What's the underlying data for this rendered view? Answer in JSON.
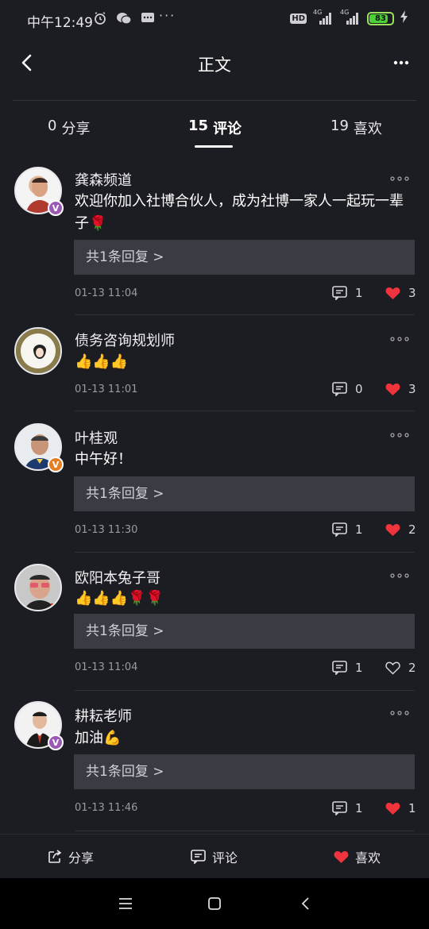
{
  "status_bar": {
    "time": "中午12:49",
    "icons": [
      "alarm-icon",
      "wechat-icon",
      "message-icon"
    ],
    "more": "···",
    "network_1": "4G",
    "network_2": "4G",
    "battery": "83",
    "battery_level": 0.83,
    "battery_color": "#4cd137"
  },
  "header": {
    "title": "正文",
    "back_icon": "chevron-left-icon",
    "more_icon": "more-horizontal-icon"
  },
  "tabs": [
    {
      "count": "0",
      "label": "分享"
    },
    {
      "count": "15",
      "label": "评论"
    },
    {
      "count": "19",
      "label": "喜欢"
    }
  ],
  "comments": [
    {
      "author": "龚森频道",
      "text": "欢迎你加入社博合伙人，成为社博一家人一起玩一辈子🌹",
      "reply": "共1条回复 >",
      "time": "01-13 11:04",
      "comment_count": "1",
      "like_count": "3",
      "liked": true,
      "badge": "V"
    },
    {
      "author": "债务咨询规划师",
      "text": "👍👍👍",
      "reply": "",
      "time": "01-13 11:01",
      "comment_count": "0",
      "like_count": "3",
      "liked": true,
      "badge": ""
    },
    {
      "author": "叶桂观",
      "text": "中午好！",
      "reply": "共1条回复 >",
      "time": "01-13 11:30",
      "comment_count": "1",
      "like_count": "2",
      "liked": true,
      "badge": "V"
    },
    {
      "author": "欧阳本兔子哥",
      "text": "👍👍👍🌹🌹",
      "reply": "共1条回复 >",
      "time": "01-13 11:04",
      "comment_count": "1",
      "like_count": "2",
      "liked": false,
      "badge": ""
    },
    {
      "author": "耕耘老师",
      "text": "加油💪",
      "reply": "共1条回复 >",
      "time": "01-13 11:46",
      "comment_count": "1",
      "like_count": "1",
      "liked": true,
      "badge": "V"
    }
  ],
  "action_bar": {
    "share": "分享",
    "comment": "评论",
    "like": "喜欢"
  },
  "colors": {
    "background": "#1c1c23",
    "like_red": "#f0343e",
    "reply_box": "#3b3b43",
    "badge_purple": "#9b59b6",
    "badge_orange": "#e67e22"
  }
}
